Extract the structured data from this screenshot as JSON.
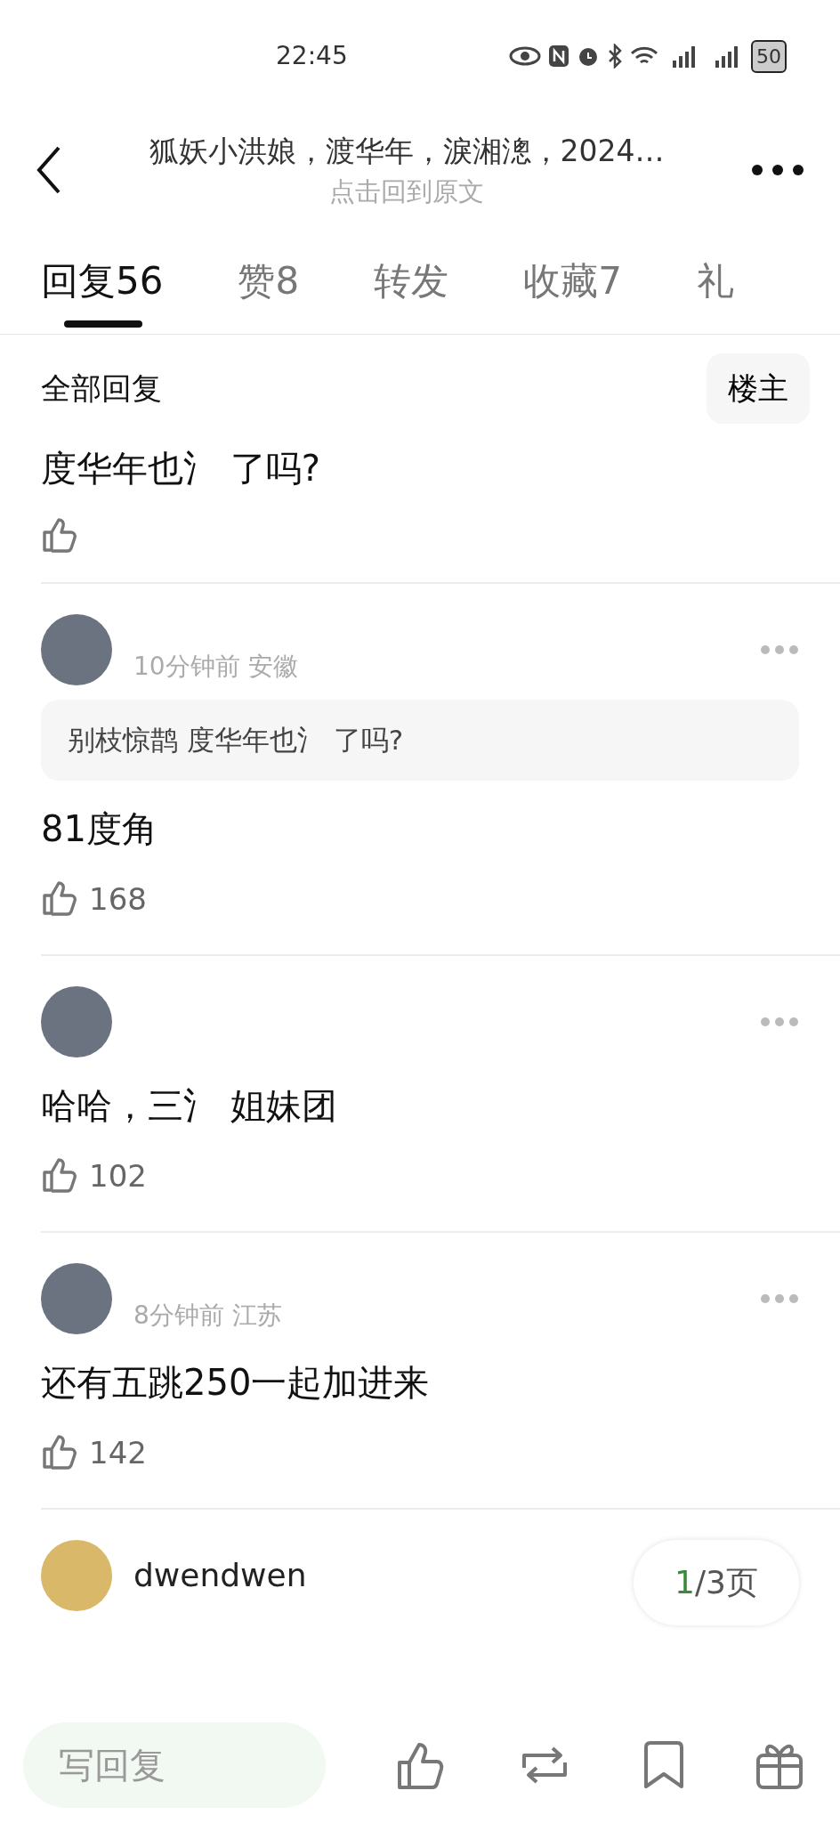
{
  "status_bar": {
    "time": "22:45",
    "battery": "50"
  },
  "header": {
    "title": "狐妖小洪娘，渡华年，淚湘漗，2024…",
    "subtitle": "点击回到原文"
  },
  "tabs": [
    {
      "label": "回复",
      "count": "56",
      "selected": true
    },
    {
      "label": "赞",
      "count": "8",
      "selected": false
    },
    {
      "label": "转发",
      "selected": false
    },
    {
      "label": "收藏",
      "count": "7",
      "selected": false
    },
    {
      "label": "礼",
      "selected": false
    }
  ],
  "filter": {
    "label": "全部回复",
    "button": "楼主"
  },
  "comments": [
    {
      "kind": "cut",
      "text": "度华年也氵 了吗?"
    },
    {
      "kind": "full",
      "meta": "10分钟前 安徽",
      "quote_user": "别枝惊鹊",
      "quote_text": "度华年也氵 了吗?",
      "text": "81度角",
      "likes": "168"
    },
    {
      "kind": "full",
      "text": "哈哈，三氵 姐妹团",
      "likes": "102"
    },
    {
      "kind": "full",
      "meta": "8分钟前 江苏",
      "text": "还有五跳250一起加进来",
      "likes": "142"
    },
    {
      "kind": "partial",
      "name": "dwendwen"
    }
  ],
  "pager": {
    "current": "1",
    "total": "/3页"
  },
  "reply_bar": {
    "placeholder": "写回复"
  }
}
